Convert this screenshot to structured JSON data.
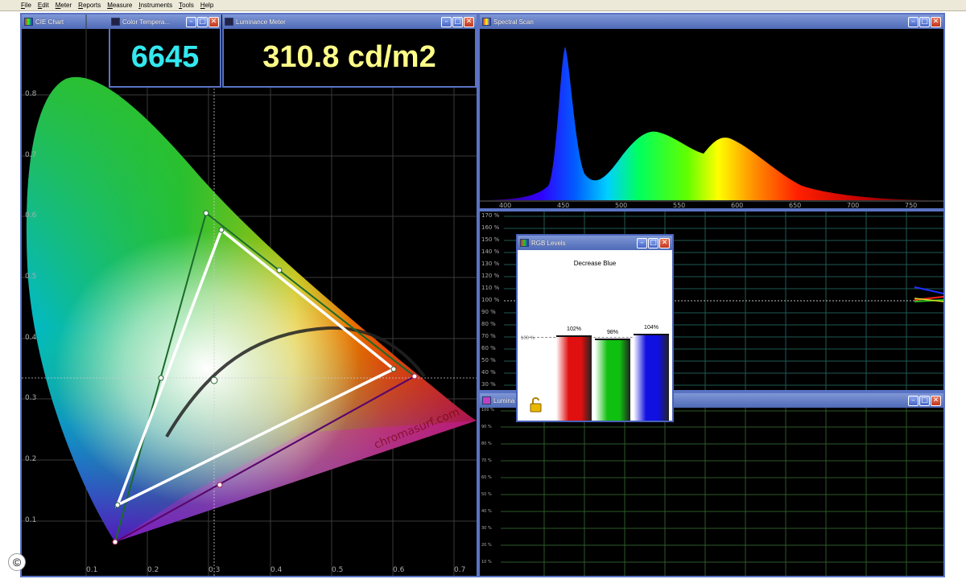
{
  "menu": [
    "File",
    "Edit",
    "Meter",
    "Reports",
    "Measure",
    "Instruments",
    "Tools",
    "Help"
  ],
  "cie_window": {
    "title": "CIE Chart",
    "y_ticks": [
      "0.8",
      "0.7",
      "0.6",
      "0.5",
      "0.4",
      "0.3",
      "0.2",
      "0.1"
    ],
    "x_ticks": [
      "0.1",
      "0.2",
      "0.3",
      "0.4",
      "0.5",
      "0.6",
      "0.7"
    ],
    "watermark": "chromasurf.com"
  },
  "color_temp_window": {
    "title": "Color Tempera...",
    "value": "6645",
    "color": "#33e8f0"
  },
  "luminance_meter_window": {
    "title": "Luminance Meter",
    "value": "310.8 cd/m2",
    "color": "#ffff88"
  },
  "spectral_window": {
    "title": "Spectral Scan",
    "x_ticks": [
      "400",
      "450",
      "500",
      "550",
      "600",
      "650",
      "700",
      "750"
    ]
  },
  "levels_window": {
    "y_ticks": [
      "170 %",
      "160 %",
      "150 %",
      "140 %",
      "130 %",
      "120 %",
      "110 %",
      "100 %",
      "90 %",
      "80 %",
      "70 %",
      "60 %",
      "50 %",
      "40 %",
      "30 %"
    ]
  },
  "rgb_levels_dialog": {
    "title": "RGB Levels",
    "instruction": "Decrease Blue",
    "reference_label": "100 %",
    "bars": [
      {
        "name": "red",
        "label": "102%",
        "value": 102,
        "color": "#e01010"
      },
      {
        "name": "green",
        "label": "98%",
        "value": 98,
        "color": "#10c010"
      },
      {
        "name": "blue",
        "label": "104%",
        "value": 104,
        "color": "#1010e0"
      }
    ],
    "lock_icon": "unlocked-padlock-icon"
  },
  "luminance_window": {
    "title": "Lumina",
    "y_ticks": [
      "100 %",
      "90 %",
      "80 %",
      "70 %",
      "60 %",
      "50 %",
      "40 %",
      "30 %",
      "20 %",
      "10 %"
    ]
  },
  "copyright_symbol": "©"
}
